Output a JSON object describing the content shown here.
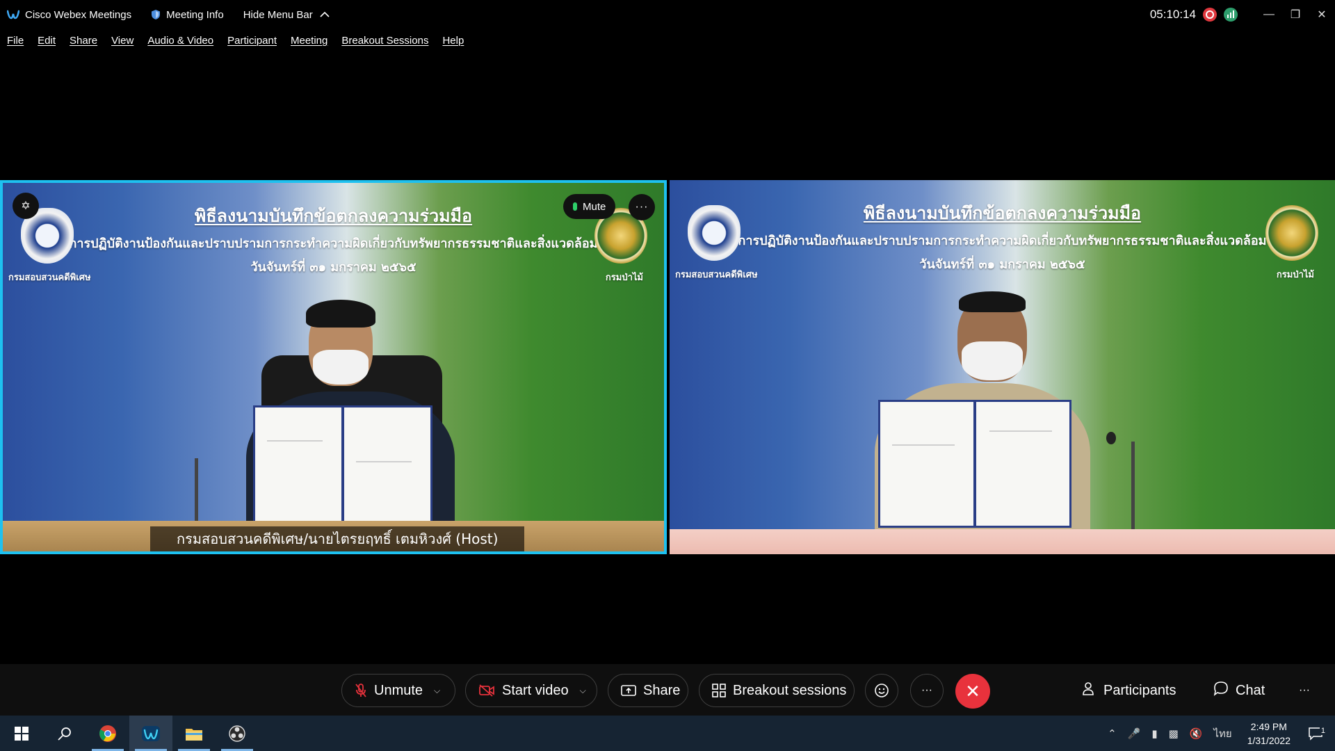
{
  "titlebar": {
    "app_name": "Cisco Webex Meetings",
    "meeting_info": "Meeting Info",
    "hide_menu": "Hide Menu Bar",
    "timer": "05:10:14"
  },
  "menu": [
    "File",
    "Edit",
    "Share",
    "View",
    "Audio & Video",
    "Participant",
    "Meeting",
    "Breakout Sessions",
    "Help"
  ],
  "banner": {
    "line1": "พิธีลงนามบันทึกข้อตกลงความร่วมมือ",
    "line2": "การปฏิบัติงานป้องกันและปราบปรามการกระทำความผิดเกี่ยวกับทรัพยากรธรรมชาติและสิ่งแวดล้อม",
    "line3": "วันจันทร์ที่ ๓๑ มกราคม ๒๕๖๕",
    "left_caption": "กรมสอบสวนคดีพิเศษ",
    "right_caption": "กรมป่าไม้"
  },
  "tiles": {
    "left_name": "กรมสอบสวนคดีพิเศษ/นายไตรยฤทธิ์ เตมหิวงศ์  (Host)",
    "mute_label": "Mute",
    "more_label": "···"
  },
  "controls": {
    "unmute": "Unmute",
    "start_video": "Start video",
    "share": "Share",
    "breakout": "Breakout sessions",
    "more": "···",
    "participants": "Participants",
    "chat": "Chat",
    "overflow": "···"
  },
  "taskbar": {
    "language": "ไทย",
    "time": "2:49 PM",
    "date": "1/31/2022",
    "notification_count": "1"
  },
  "colors": {
    "active_border": "#1ec1f0",
    "end_call": "#e8323c",
    "recording": "#e0383e",
    "health": "#2d9e6c"
  }
}
